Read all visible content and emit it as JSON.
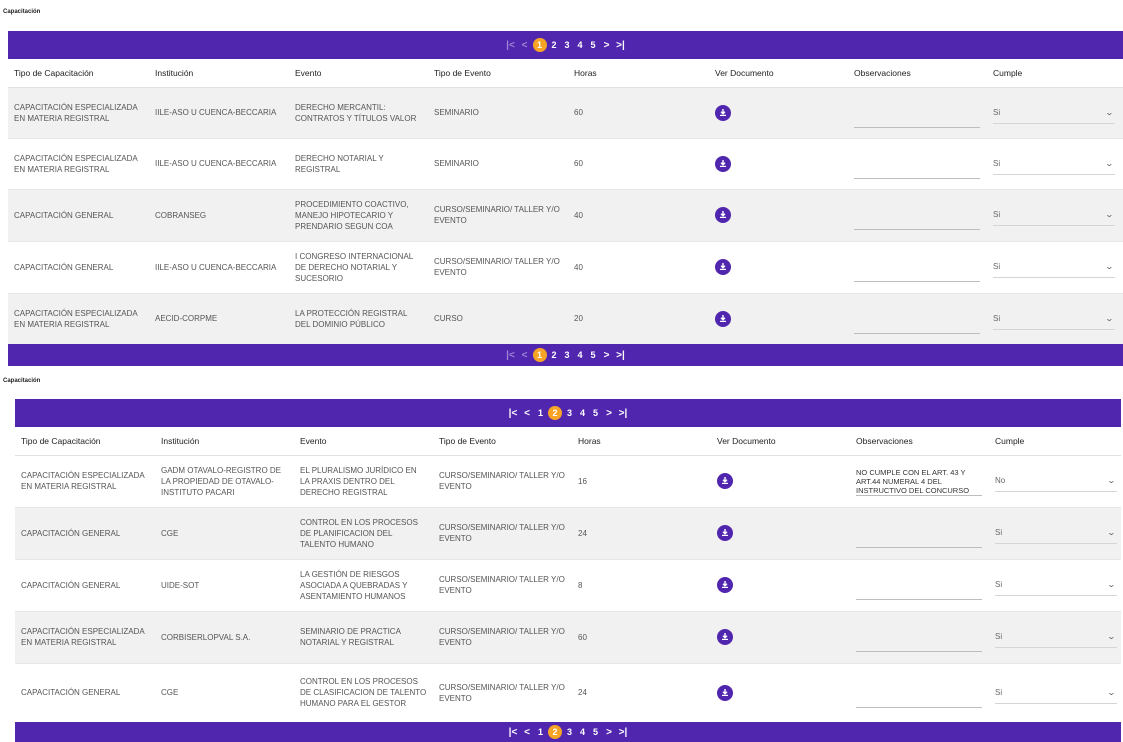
{
  "sections": [
    {
      "title": "Capacitación",
      "pagination": {
        "first": "|<",
        "prev": "<",
        "pages": [
          "1",
          "2",
          "3",
          "4",
          "5"
        ],
        "current": "1",
        "next": ">",
        "last": ">|"
      },
      "columns": [
        "Tipo de Capacitación",
        "Institución",
        "Evento",
        "Tipo de Evento",
        "Horas",
        "Ver Documento",
        "Observaciones",
        "Cumple"
      ],
      "rows": [
        {
          "tipo": "CAPACITACIÓN ESPECIALIZADA EN MATERIA REGISTRAL",
          "institucion": "IILE-ASO U CUENCA-BECCARIA",
          "evento": "DERECHO MERCANTIL: CONTRATOS Y TÍTULOS VALOR",
          "tipo_evento": "SEMINARIO",
          "horas": "60",
          "observaciones": "",
          "cumple": "Si"
        },
        {
          "tipo": "CAPACITACIÓN ESPECIALIZADA EN MATERIA REGISTRAL",
          "institucion": "IILE-ASO U CUENCA-BECCARIA",
          "evento": "DERECHO NOTARIAL Y REGISTRAL",
          "tipo_evento": "SEMINARIO",
          "horas": "60",
          "observaciones": "",
          "cumple": "Si"
        },
        {
          "tipo": "CAPACITACIÓN GENERAL",
          "institucion": "COBRANSEG",
          "evento": "PROCEDIMIENTO COACTIVO, MANEJO HIPOTECARIO Y PRENDARIO SEGUN COA",
          "tipo_evento": "CURSO/SEMINARIO/ TALLER Y/O EVENTO",
          "horas": "40",
          "observaciones": "",
          "cumple": "Si"
        },
        {
          "tipo": "CAPACITACIÓN GENERAL",
          "institucion": "IILE-ASO U CUENCA-BECCARIA",
          "evento": "I CONGRESO INTERNACIONAL DE DERECHO NOTARIAL Y SUCESORIO",
          "tipo_evento": "CURSO/SEMINARIO/ TALLER Y/O EVENTO",
          "horas": "40",
          "observaciones": "",
          "cumple": "Si"
        },
        {
          "tipo": "CAPACITACIÓN ESPECIALIZADA EN MATERIA REGISTRAL",
          "institucion": "AECID-CORPME",
          "evento": "LA PROTECCIÓN REGISTRAL DEL DOMINIO PÚBLICO",
          "tipo_evento": "CURSO",
          "horas": "20",
          "observaciones": "",
          "cumple": "Si"
        }
      ]
    },
    {
      "title": "Capacitación",
      "pagination": {
        "first": "|<",
        "prev": "<",
        "pages": [
          "1",
          "2",
          "3",
          "4",
          "5"
        ],
        "current": "2",
        "next": ">",
        "last": ">|"
      },
      "columns": [
        "Tipo de Capacitación",
        "Institución",
        "Evento",
        "Tipo de Evento",
        "Horas",
        "Ver Documento",
        "Observaciones",
        "Cumple"
      ],
      "rows": [
        {
          "tipo": "CAPACITACIÓN ESPECIALIZADA EN MATERIA REGISTRAL",
          "institucion": "GADM OTAVALO-REGISTRO DE LA PROPIEDAD DE OTAVALO-INSTITUTO PACARI",
          "evento": "EL PLURALISMO JURÍDICO EN LA PRAXIS DENTRO DEL DERECHO REGISTRAL",
          "tipo_evento": "CURSO/SEMINARIO/ TALLER Y/O EVENTO",
          "horas": "16",
          "observaciones": "NO CUMPLE CON EL ART. 43 Y ART.44 NUMERAL 4 DEL INSTRUCTIVO DEL CONCURSO",
          "cumple": "No"
        },
        {
          "tipo": "CAPACITACIÓN GENERAL",
          "institucion": "CGE",
          "evento": "CONTROL EN LOS PROCESOS DE PLANIFICACION DEL TALENTO HUMANO",
          "tipo_evento": "CURSO/SEMINARIO/ TALLER Y/O EVENTO",
          "horas": "24",
          "observaciones": "",
          "cumple": "Si"
        },
        {
          "tipo": "CAPACITACIÓN GENERAL",
          "institucion": "UIDE-SOT",
          "evento": "LA GESTIÓN DE RIESGOS ASOCIADA A QUEBRADAS Y ASENTAMIENTO HUMANOS",
          "tipo_evento": "CURSO/SEMINARIO/ TALLER Y/O EVENTO",
          "horas": "8",
          "observaciones": "",
          "cumple": "Si"
        },
        {
          "tipo": "CAPACITACIÓN ESPECIALIZADA EN MATERIA REGISTRAL",
          "institucion": "CORBISERLOPVAL S.A.",
          "evento": "SEMINARIO DE PRACTICA NOTARIAL Y REGISTRAL",
          "tipo_evento": "CURSO/SEMINARIO/ TALLER Y/O EVENTO",
          "horas": "60",
          "observaciones": "",
          "cumple": "Si"
        },
        {
          "tipo": "CAPACITACIÓN GENERAL",
          "institucion": "CGE",
          "evento": "CONTROL EN LOS PROCESOS DE CLASIFICACION DE TALENTO HUMANO PARA EL GESTOR",
          "tipo_evento": "CURSO/SEMINARIO/ TALLER Y/O EVENTO",
          "horas": "24",
          "observaciones": "",
          "cumple": "Si"
        }
      ]
    }
  ],
  "colors": {
    "primary": "#5126ae",
    "current_page": "#f7a326",
    "row_alt": "#f1f1f1"
  },
  "icons": {
    "download": "download-circle-icon",
    "dropdown": "chevron-down-icon"
  }
}
